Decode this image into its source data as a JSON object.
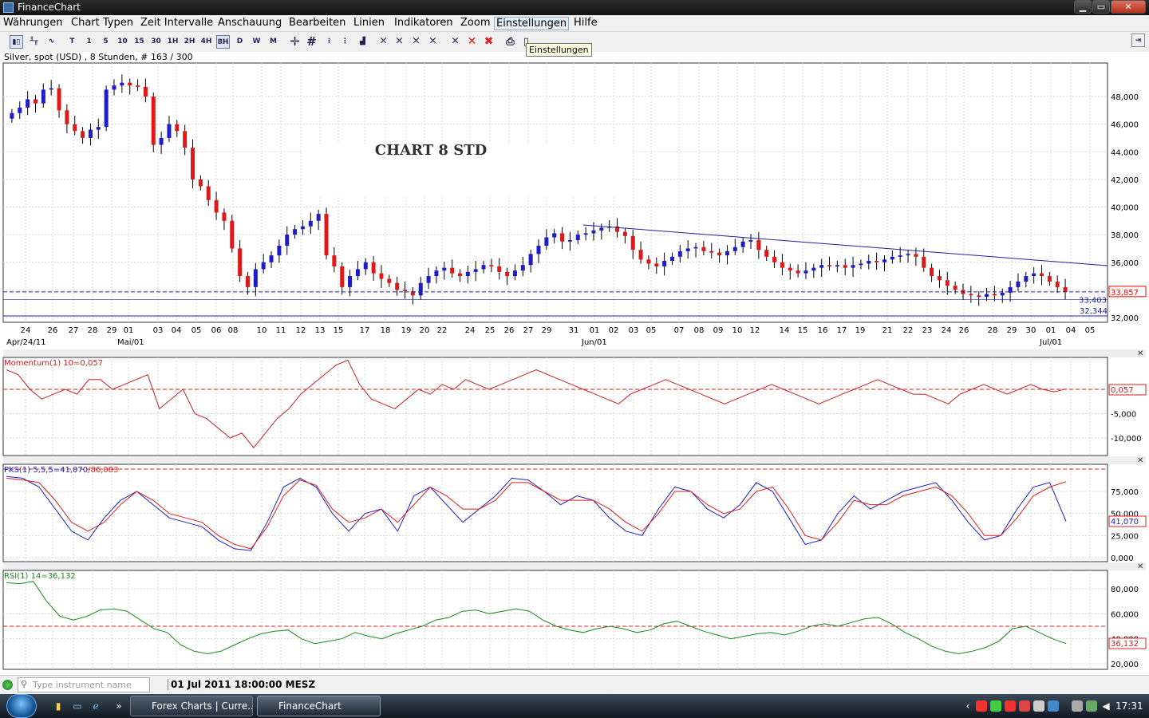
{
  "window": {
    "title": "FinanceChart",
    "min": "▁",
    "max": "▭",
    "close": "✕"
  },
  "menu": [
    "Währungen",
    "Chart Typen",
    "Zeit Intervalle",
    "Anschauung",
    "Bearbeiten",
    "Linien",
    "Indikatoren",
    "Zoom",
    "Einstellungen",
    "Hilfe"
  ],
  "menu_active_index": 8,
  "toolbar": {
    "period_buttons": [
      "T",
      "1",
      "5",
      "10",
      "15",
      "30",
      "1H",
      "2H",
      "4H",
      "8H",
      "D",
      "W",
      "M"
    ],
    "selected_period": "8H",
    "tooltip": "Einstellungen"
  },
  "info_line": "Silver, spot (USD) , 8 Stunden, # 163 / 300",
  "colors": {
    "up": "#1c1cc8",
    "down": "#e01818",
    "grid": "#d8d8d8",
    "momentum": "#cc2020",
    "pks_fast": "#2020c0",
    "pks_slow": "#dd2020",
    "rsi": "#1a8a1a",
    "ref_line": "#cc2020",
    "trend": "#2020a0",
    "price_hl": "#ff0000"
  },
  "price_panel": {
    "annotation": "CHART 8 STD",
    "y_axis": [
      "48,000",
      "46,000",
      "44,000",
      "42,000",
      "40,000",
      "38,000",
      "36,000",
      "34,000",
      "32,000"
    ],
    "y_values": [
      48,
      46,
      44,
      42,
      40,
      38,
      36,
      34,
      32
    ],
    "current_price_label": "33,857",
    "current_price": 33.857,
    "line1_label": "33,403",
    "line1": 33.403,
    "line2_label": "32,344",
    "line2": 32.344,
    "x_days": [
      "24",
      "26",
      "27",
      "28",
      "29",
      "01",
      "03",
      "04",
      "05",
      "06",
      "08",
      "10",
      "11",
      "12",
      "13",
      "15",
      "17",
      "18",
      "19",
      "20",
      "22",
      "24",
      "25",
      "26",
      "27",
      "29",
      "31",
      "01",
      "02",
      "03",
      "05",
      "07",
      "08",
      "09",
      "10",
      "12",
      "14",
      "15",
      "16",
      "17",
      "19",
      "21",
      "22",
      "23",
      "24",
      "26",
      "28",
      "29",
      "30",
      "01",
      "04",
      "05"
    ],
    "x_months": [
      "Apr/24/11",
      "Mai/01",
      "Jun/01",
      "Jul/01"
    ]
  },
  "momentum_panel": {
    "label": "Momentum(1) 10=0,057",
    "value_label": "0,057",
    "y_axis": [
      "-5,000",
      "-10,000"
    ],
    "y_values": [
      -5,
      -10
    ]
  },
  "pks_panel": {
    "label_a": "PKS(1) 5,5,5=41,070",
    "label_b": "/86,083",
    "value_label": "41,070",
    "y_axis": [
      "75,000",
      "50,000",
      "25,000",
      "0,000"
    ],
    "y_values": [
      75,
      50,
      25,
      0
    ]
  },
  "rsi_panel": {
    "label": "RSI(1) 14=36,132",
    "value_label": "36,132",
    "y_axis": [
      "80,000",
      "60,000",
      "40,000",
      "20,000"
    ],
    "y_values": [
      80,
      60,
      40,
      20
    ]
  },
  "chart_data": {
    "type": "line",
    "title": "Silver, spot (USD) , 8 Stunden, # 163 / 300",
    "ohlc_approx_close": [
      46.8,
      47.2,
      47.8,
      47.5,
      48.5,
      48.6,
      47.0,
      46.0,
      45.5,
      45.0,
      45.6,
      45.8,
      48.5,
      48.8,
      49.0,
      48.8,
      48.7,
      48.0,
      44.5,
      45.0,
      46.0,
      45.5,
      44.3,
      42.0,
      41.5,
      40.5,
      39.6,
      39.0,
      37.0,
      35.0,
      34.2,
      35.5,
      36.0,
      36.5,
      37.2,
      38.0,
      38.4,
      38.6,
      39.0,
      39.5,
      36.5,
      35.7,
      34.2,
      35.0,
      35.5,
      36.0,
      35.2,
      34.8,
      34.5,
      34.0,
      33.9,
      33.6,
      34.5,
      35.0,
      35.4,
      35.6,
      35.2,
      35.0,
      35.3,
      35.5,
      35.8,
      35.7,
      35.3,
      35.0,
      35.4,
      35.8,
      36.6,
      37.2,
      37.8,
      38.1,
      37.5,
      37.6,
      38.0,
      38.1,
      38.3,
      38.5,
      38.6,
      38.2,
      37.9,
      36.9,
      36.2,
      35.9,
      35.7,
      36.1,
      36.4,
      36.8,
      37.0,
      37.1,
      36.8,
      36.7,
      36.5,
      36.8,
      37.1,
      37.5,
      37.6,
      36.9,
      36.4,
      36.0,
      35.6,
      35.4,
      35.2,
      35.4,
      35.6,
      35.8,
      35.7,
      35.8,
      35.6,
      35.8,
      35.9,
      36.1,
      36.0,
      36.2,
      36.4,
      36.5,
      36.6,
      36.4,
      35.6,
      35.0,
      34.7,
      34.3,
      34.0,
      33.7,
      33.6,
      33.5,
      33.7,
      33.6,
      33.8,
      34.2,
      34.6,
      35.0,
      35.2,
      35.0,
      34.6,
      34.2,
      33.857
    ],
    "momentum": [
      4,
      3,
      0,
      -2,
      -1,
      0,
      -1,
      2,
      2,
      0,
      1,
      2,
      3,
      -4,
      -2,
      0,
      -5,
      -6,
      -8,
      -10,
      -9,
      -12,
      -9,
      -6,
      -4,
      -1,
      1,
      3,
      5,
      6,
      1,
      -2,
      -3,
      -4,
      -2,
      0,
      -1,
      1,
      0,
      2,
      1,
      0,
      1,
      2,
      3,
      4,
      3,
      2,
      1,
      0,
      -1,
      -2,
      -3,
      -1,
      0,
      1,
      2,
      1,
      0,
      -1,
      -2,
      -3,
      -2,
      -1,
      0,
      1,
      0,
      -1,
      -2,
      -3,
      -2,
      -1,
      0,
      1,
      2,
      1,
      0,
      -1,
      -1,
      -2,
      -3,
      -1,
      0,
      1,
      0,
      -1,
      0,
      1,
      0,
      -0.5,
      0.057
    ],
    "pks_fast": [
      92,
      90,
      80,
      55,
      30,
      20,
      45,
      65,
      75,
      60,
      45,
      40,
      35,
      20,
      10,
      8,
      40,
      80,
      90,
      80,
      50,
      30,
      50,
      55,
      30,
      70,
      80,
      60,
      40,
      55,
      70,
      90,
      88,
      75,
      60,
      70,
      65,
      45,
      30,
      25,
      55,
      80,
      75,
      55,
      45,
      60,
      85,
      75,
      45,
      15,
      20,
      50,
      70,
      55,
      65,
      75,
      80,
      85,
      65,
      40,
      20,
      25,
      55,
      80,
      85,
      41.07
    ],
    "pks_slow": [
      90,
      88,
      85,
      65,
      40,
      30,
      40,
      60,
      75,
      65,
      50,
      45,
      40,
      25,
      15,
      10,
      35,
      70,
      88,
      82,
      55,
      40,
      45,
      55,
      40,
      60,
      80,
      70,
      55,
      55,
      65,
      85,
      85,
      75,
      65,
      65,
      65,
      55,
      40,
      30,
      50,
      75,
      75,
      60,
      50,
      55,
      75,
      80,
      55,
      25,
      20,
      40,
      65,
      60,
      60,
      70,
      75,
      80,
      70,
      50,
      25,
      25,
      45,
      70,
      80,
      86.083
    ],
    "rsi": [
      85,
      84,
      86,
      70,
      58,
      55,
      58,
      63,
      64,
      62,
      55,
      48,
      45,
      35,
      30,
      28,
      30,
      35,
      40,
      44,
      46,
      47,
      40,
      36,
      38,
      40,
      45,
      42,
      40,
      44,
      47,
      50,
      55,
      57,
      62,
      63,
      60,
      62,
      64,
      62,
      55,
      50,
      47,
      45,
      48,
      50,
      48,
      45,
      47,
      52,
      54,
      50,
      46,
      43,
      40,
      42,
      44,
      45,
      43,
      46,
      50,
      52,
      50,
      53,
      56,
      57,
      52,
      45,
      40,
      34,
      30,
      28,
      30,
      33,
      38,
      48,
      50,
      45,
      40,
      36.132
    ]
  }
}
